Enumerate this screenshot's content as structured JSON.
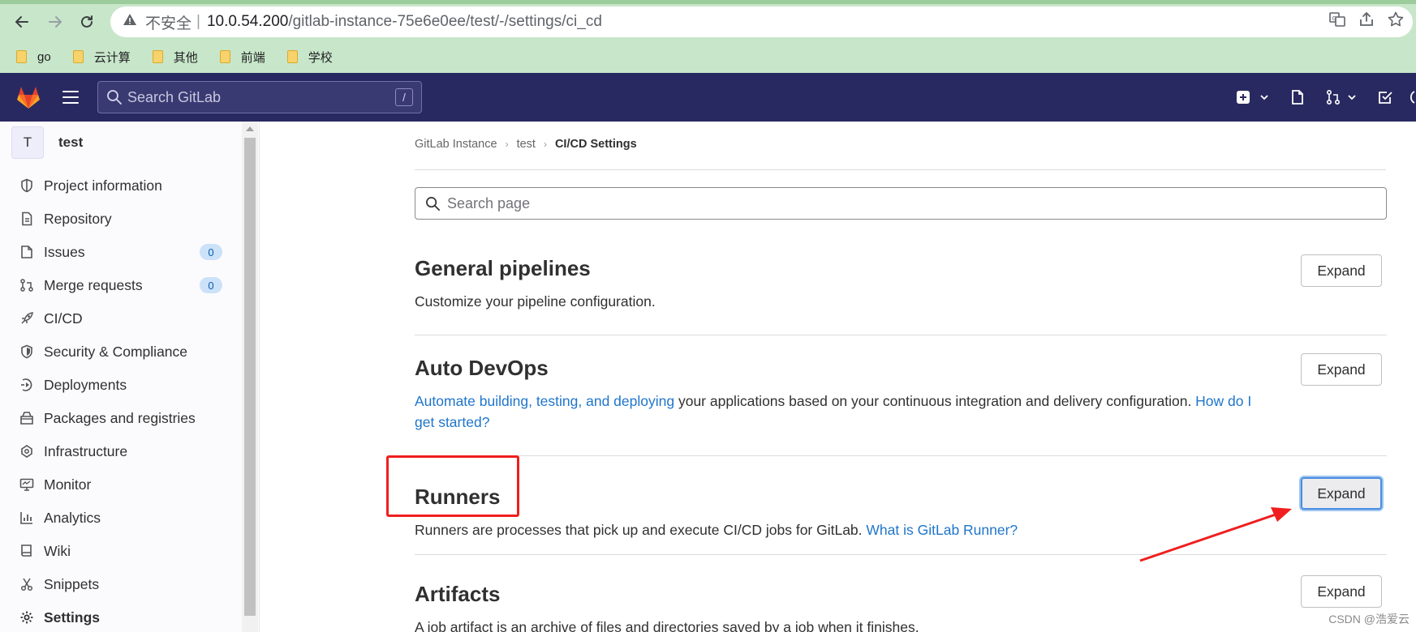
{
  "browser": {
    "security_label": "不安全",
    "separator": "|",
    "url_host": "10.0.54.200",
    "url_path": "/gitlab-instance-75e6e0ee/test/-/settings/ci_cd",
    "bookmarks": [
      "go",
      "云计算",
      "其他",
      "前端",
      "学校"
    ]
  },
  "header": {
    "search_placeholder": "Search GitLab",
    "search_shortcut": "/"
  },
  "project": {
    "avatar_letter": "T",
    "name": "test"
  },
  "sidebar": {
    "items": [
      {
        "label": "Project information",
        "icon": "project-info-icon"
      },
      {
        "label": "Repository",
        "icon": "repository-icon"
      },
      {
        "label": "Issues",
        "icon": "issues-icon",
        "count": "0"
      },
      {
        "label": "Merge requests",
        "icon": "merge-request-icon",
        "count": "0"
      },
      {
        "label": "CI/CD",
        "icon": "rocket-icon"
      },
      {
        "label": "Security & Compliance",
        "icon": "shield-icon"
      },
      {
        "label": "Deployments",
        "icon": "deployments-icon"
      },
      {
        "label": "Packages and registries",
        "icon": "package-icon"
      },
      {
        "label": "Infrastructure",
        "icon": "cloud-icon"
      },
      {
        "label": "Monitor",
        "icon": "monitor-icon"
      },
      {
        "label": "Analytics",
        "icon": "chart-icon"
      },
      {
        "label": "Wiki",
        "icon": "book-icon"
      },
      {
        "label": "Snippets",
        "icon": "scissors-icon"
      },
      {
        "label": "Settings",
        "icon": "settings-icon",
        "active": true
      }
    ]
  },
  "breadcrumb": {
    "items": [
      "GitLab Instance",
      "test",
      "CI/CD Settings"
    ]
  },
  "page_search": {
    "placeholder": "Search page"
  },
  "sections": {
    "general": {
      "title": "General pipelines",
      "description": "Customize your pipeline configuration.",
      "button": "Expand"
    },
    "autodevops": {
      "title": "Auto DevOps",
      "link1": "Automate building, testing, and deploying",
      "text": " your applications based on your continuous integration and delivery configuration. ",
      "link2_line1": "How do I",
      "link2_line2": "get started?",
      "button": "Expand"
    },
    "runners": {
      "title": "Runners",
      "text": "Runners are processes that pick up and execute CI/CD jobs for GitLab. ",
      "link": "What is GitLab Runner?",
      "button": "Expand"
    },
    "artifacts": {
      "title": "Artifacts",
      "description": "A job artifact is an archive of files and directories saved by a job when it finishes.",
      "button": "Expand"
    }
  },
  "watermark": "CSDN @浩爱云"
}
